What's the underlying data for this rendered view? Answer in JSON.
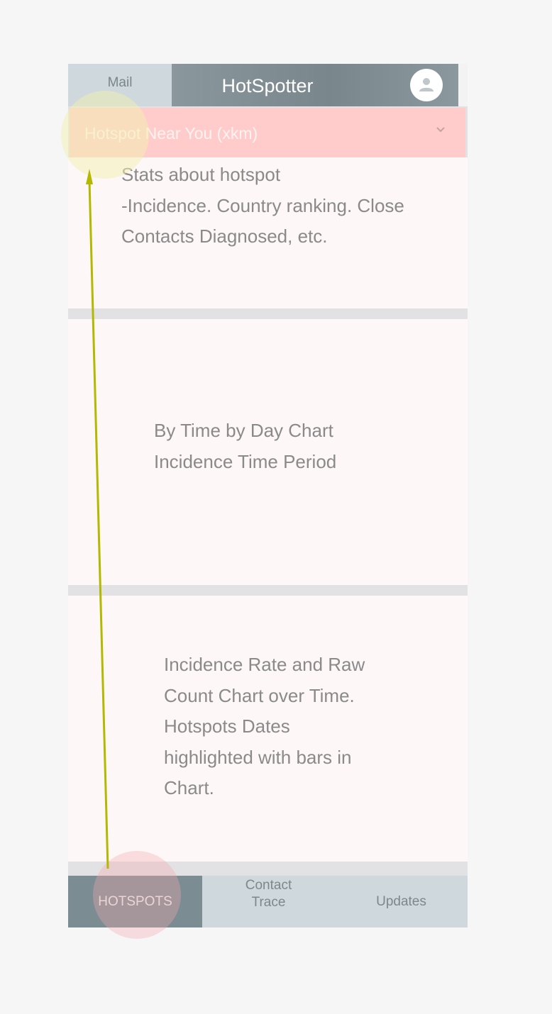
{
  "header": {
    "mail_tab": "Mail",
    "app_title": "HotSpotter",
    "avatar_icon": "account-circle-icon"
  },
  "dropdown": {
    "label": "Hotspot Near You (xkm)",
    "chevron_icon": "chevron-down-icon"
  },
  "cards": {
    "stats": {
      "lines": [
        "Stats about hotspot",
        "-Incidence. Country ranking. Close",
        "Contacts Diagnosed, etc."
      ]
    },
    "time_chart": {
      "lines": [
        "By Time by Day Chart",
        "Incidence Time Period"
      ]
    },
    "rate_chart": {
      "lines": [
        "Incidence Rate and Raw",
        "Count Chart over Time.",
        "Hotspots Dates",
        "highlighted with bars in",
        "Chart."
      ]
    }
  },
  "bottom_nav": {
    "hotspots": "HOTSPOTS",
    "contact_line1": "Contact",
    "contact_line2": "Trace",
    "updates": "Updates"
  },
  "colors": {
    "page_bg": "#f6f6f6",
    "header_gray": "#7f8d93",
    "mail_tab_bg": "#cfd8dc",
    "dropdown_bg": "#ffcccb",
    "card_bg": "#fdf7f7",
    "separator": "#e2e2e4",
    "nav_active_bg": "#7c8c93",
    "annotation_arrow": "#b5b800",
    "tap_start_circle": "#f3a8b0",
    "tap_end_circle": "#f2f0b0"
  }
}
